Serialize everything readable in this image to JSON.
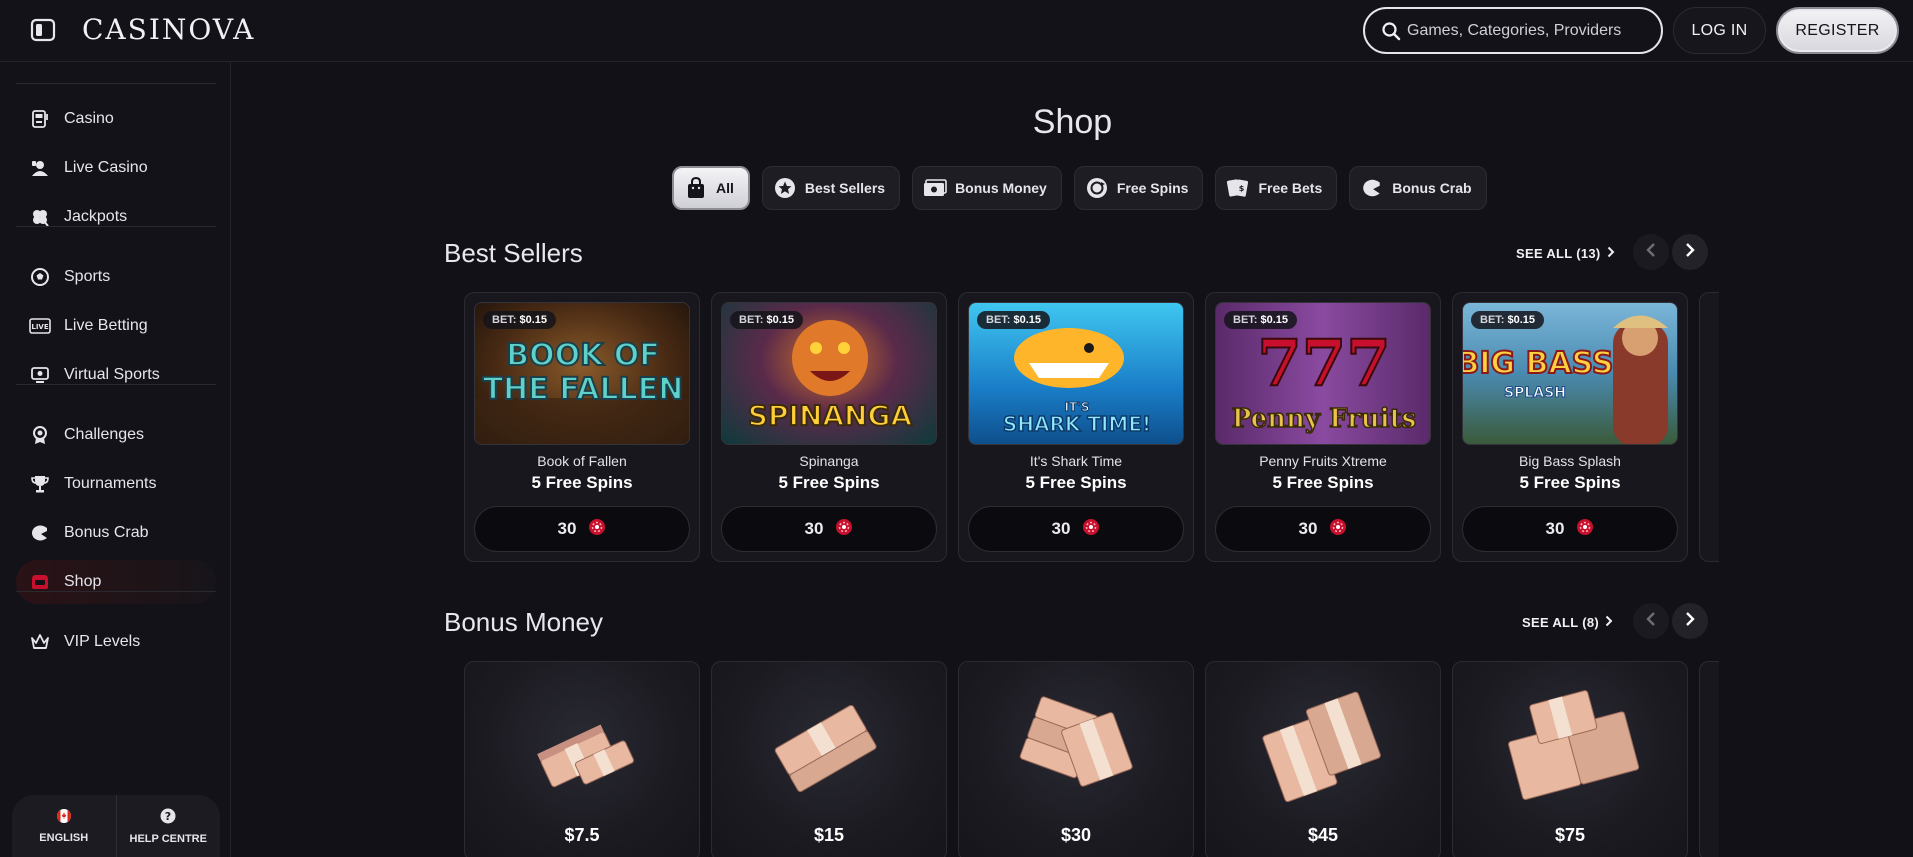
{
  "header": {
    "logo": "CASINOVA",
    "search_placeholder": "Games, Categories, Providers",
    "login_label": "LOG IN",
    "register_label": "REGISTER"
  },
  "sidebar": {
    "items": [
      {
        "label": "Casino",
        "icon": "slot-machine-icon"
      },
      {
        "label": "Live Casino",
        "icon": "dealer-icon"
      },
      {
        "label": "Jackpots",
        "icon": "clover-icon"
      },
      {
        "label": "Sports",
        "icon": "soccer-ball-icon"
      },
      {
        "label": "Live Betting",
        "icon": "live-icon"
      },
      {
        "label": "Virtual Sports",
        "icon": "monitor-icon"
      },
      {
        "label": "Challenges",
        "icon": "medal-icon"
      },
      {
        "label": "Tournaments",
        "icon": "trophy-icon"
      },
      {
        "label": "Bonus Crab",
        "icon": "crab-claw-icon"
      },
      {
        "label": "Shop",
        "icon": "shop-icon",
        "active": true
      },
      {
        "label": "VIP Levels",
        "icon": "crown-icon"
      }
    ],
    "footer": {
      "language_label": "ENGLISH",
      "help_label": "HELP CENTRE"
    }
  },
  "main": {
    "title": "Shop",
    "filters": [
      {
        "label": "All",
        "icon": "shopping-bag-icon",
        "active": true
      },
      {
        "label": "Best Sellers",
        "icon": "star-badge-icon"
      },
      {
        "label": "Bonus Money",
        "icon": "cash-icon"
      },
      {
        "label": "Free Spins",
        "icon": "spin-icon"
      },
      {
        "label": "Free Bets",
        "icon": "ticket-icon"
      },
      {
        "label": "Bonus Crab",
        "icon": "crab-claw-icon"
      }
    ],
    "best_sellers": {
      "title": "Best Sellers",
      "see_all": "SEE ALL (13)",
      "cards": [
        {
          "bet_label": "BET:",
          "bet_value": "$0.15",
          "game": "Book of Fallen",
          "prize": "5 Free Spins",
          "price": "30"
        },
        {
          "bet_label": "BET:",
          "bet_value": "$0.15",
          "game": "Spinanga",
          "prize": "5 Free Spins",
          "price": "30"
        },
        {
          "bet_label": "BET:",
          "bet_value": "$0.15",
          "game": "It's Shark Time",
          "prize": "5 Free Spins",
          "price": "30"
        },
        {
          "bet_label": "BET:",
          "bet_value": "$0.15",
          "game": "Penny Fruits Xtreme",
          "prize": "5 Free Spins",
          "price": "30"
        },
        {
          "bet_label": "BET:",
          "bet_value": "$0.15",
          "game": "Big Bass Splash",
          "prize": "5 Free Spins",
          "price": "30"
        }
      ],
      "thumb_art": [
        {
          "line1": "BOOK OF",
          "line2": "THE FALLEN"
        },
        {
          "line1": "SPINANGA",
          "line2": ""
        },
        {
          "line1": "IT'S",
          "line2": "SHARK TIME!"
        },
        {
          "line1": "777",
          "line2": "Penny Fruits"
        },
        {
          "line1": "BIG BASS",
          "line2": "SPLASH"
        }
      ]
    },
    "bonus_money": {
      "title": "Bonus Money",
      "see_all": "SEE ALL (8)",
      "cards": [
        {
          "amount": "$7.5"
        },
        {
          "amount": "$15"
        },
        {
          "amount": "$30"
        },
        {
          "amount": "$45"
        },
        {
          "amount": "$75"
        }
      ]
    }
  },
  "colors": {
    "background": "#121117",
    "accent_chip": "#c8102e",
    "card_bg": "#18171d"
  }
}
